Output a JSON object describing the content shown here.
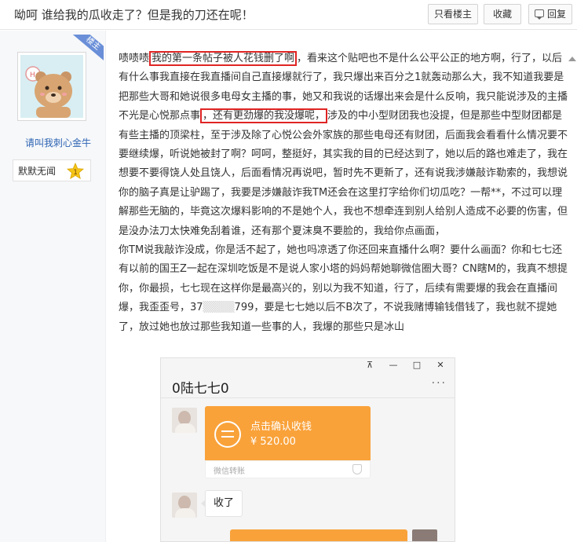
{
  "header": {
    "title": "呦呵 谁给我的瓜收走了？但是我的刀还在呢！",
    "only_owner_label": "只看楼主",
    "favorite_label": "收藏",
    "reply_label": "回复"
  },
  "author": {
    "role_badge": "楼主",
    "name": "请叫我刺心金牛",
    "level_label": "默默无闻",
    "level_number": "1"
  },
  "post": {
    "line1_prefix": "啧啧啧",
    "highlight1": "我的第一条帖子被人花钱删了啊",
    "line1_rest": "，看来这个贴吧也不是什么公平公正的地方啊，行了，以后有什么事我直接在我直播间自己直接爆就行了，我只爆出来百分之1就轰动那么大，我不知道我要是把那些大哥和她说很多电母女主播的事，她又和我说的话爆出来会是什么反响，我只能说涉及的主播不光是心悦那点事",
    "highlight2": "，还有更劲爆的我没爆呢，",
    "line1_tail": "涉及的中小型财团我也没提，但是那些中型财团都是有些主播的顶梁柱，至于涉及除了心悦公会外家族的那些电母还有财团，后面我会看看什么情况要不要继续爆，听说她被封了啊？呵呵，整挺好，其实我的目的已经达到了，她以后的路也难走了，我在想要不要得饶人处且饶人，后面看情况再说吧，暂时先不更新了，还有说我涉嫌敲诈勒索的，我想说你的脑子真是让驴踢了，我要是涉嫌敲诈我TM还会在这里打字给你们切瓜吃？一帮**，不过可以理解那些无脑的，毕竟这次爆料影响的不是她个人，我也不想牵连到别人给别人造成不必要的伤害，但是没办法刀太快难免刮着谁，还有那个夏沫臭不要脸的，我给你点画面，",
    "paragraph2": "你TM说我敲诈没成，你是活不起了，她也吗凉透了你还回来直播什么啊？要什么画面？你和七七还有以前的国王Z一起在深圳吃饭是不是说人家小塔的妈妈帮她聊微信圈大哥？CN瞎M的，我真不想提你，你最损，七七现在这样你是最高兴的，别以为我不知道，行了，后续有需要爆的我会在直播间爆，我歪歪号，37",
    "redacted": "▒▒▒▒",
    "paragraph2_after_redacted": "799，要是七七她以后不B次了，不说我赌博输钱借钱了，我也就不提她了，放过她也放过那些我知道一些事的人，我爆的那些只是冰山"
  },
  "chat_screenshot": {
    "window_controls": [
      "⊼",
      "—",
      "□",
      "✕"
    ],
    "contact_title": "0陆七七0",
    "more_icon": "···",
    "transfer_action": "点击确认收钱",
    "transfer_amount": "¥ 520.00",
    "transfer_source": "微信转账",
    "reply_message": "收了"
  },
  "colors": {
    "link_blue": "#2d64b3",
    "highlight_red": "#e02424",
    "transfer_orange": "#f9a23a",
    "badge_blue": "#6a8fd8"
  },
  "icons": {
    "reply": "reply-icon",
    "level": "star-icon",
    "transfer": "transfer-icon",
    "scroll": "scroll-up-arrow"
  }
}
